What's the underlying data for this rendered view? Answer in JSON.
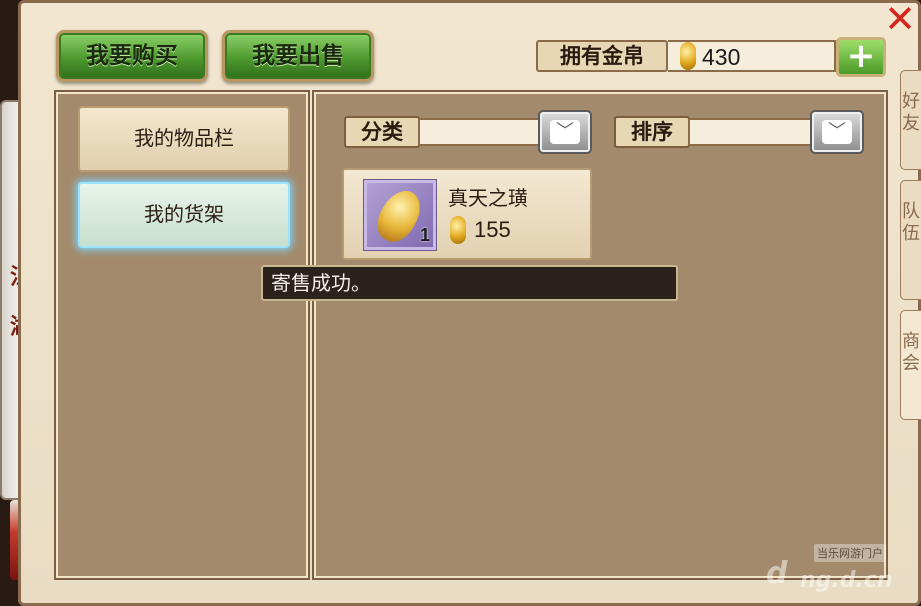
{
  "header": {
    "buy_label": "我要购买",
    "sell_label": "我要出售",
    "gold_label": "拥有金帛",
    "gold_value": "430",
    "plus_symbol": "+",
    "close_symbol": "✕"
  },
  "side_scroll": {
    "label_top": "江",
    "label_bottom": "湖"
  },
  "right_tabs": [
    "好友",
    "队伍",
    "商会"
  ],
  "left_menu": {
    "items": [
      {
        "label": "我的物品栏"
      },
      {
        "label": "我的货架"
      }
    ],
    "active_index": 1
  },
  "filters": {
    "category_label": "分类",
    "sort_label": "排序",
    "dropdown_icon": "chevron-down-icon"
  },
  "listing": {
    "name": "真天之璜",
    "quantity": "1",
    "price": "155"
  },
  "toast": {
    "message": "寄售成功。"
  },
  "watermark": {
    "site": "当乐网游门户",
    "logo": "d",
    "domain": "ng.d.cn"
  },
  "colors": {
    "button_green": "#4e9a2f",
    "close_red": "#d4261c",
    "panel_brown": "#a38a6c",
    "gold": "#e2a81c"
  }
}
